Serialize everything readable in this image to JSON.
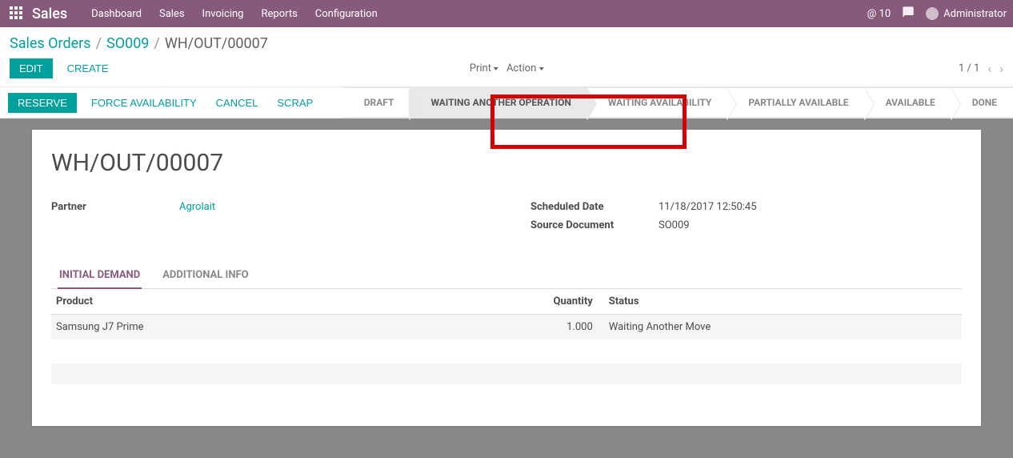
{
  "nav": {
    "brand": "Sales",
    "items": [
      "Dashboard",
      "Sales",
      "Invoicing",
      "Reports",
      "Configuration"
    ],
    "badge": "@ 10",
    "user": "Administrator"
  },
  "breadcrumb": {
    "a": "Sales Orders",
    "b": "SO009",
    "cur": "WH/OUT/00007"
  },
  "buttons": {
    "edit": "EDIT",
    "create": "CREATE",
    "reserve": "RESERVE",
    "force": "FORCE AVAILABILITY",
    "cancel": "CANCEL",
    "scrap": "SCRAP",
    "print": "Print",
    "action": "Action"
  },
  "pager": {
    "text": "1 / 1"
  },
  "statuses": [
    "DRAFT",
    "WAITING ANOTHER OPERATION",
    "WAITING AVAILABILITY",
    "PARTIALLY AVAILABLE",
    "AVAILABLE",
    "DONE"
  ],
  "active_status_index": 1,
  "record": {
    "title": "WH/OUT/00007",
    "partner_label": "Partner",
    "partner": "Agrolait",
    "sched_label": "Scheduled Date",
    "sched": "11/18/2017 12:50:45",
    "source_label": "Source Document",
    "source": "SO009"
  },
  "tabs": {
    "a": "INITIAL DEMAND",
    "b": "ADDITIONAL INFO"
  },
  "table": {
    "cols": {
      "product": "Product",
      "qty": "Quantity",
      "status": "Status"
    },
    "rows": [
      {
        "product": "Samsung J7 Prime",
        "qty": "1.000",
        "status": "Waiting Another Move"
      }
    ]
  }
}
